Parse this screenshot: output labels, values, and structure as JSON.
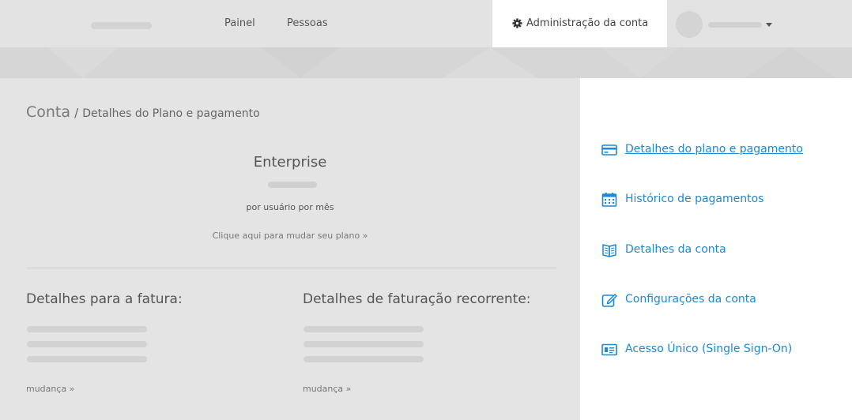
{
  "nav": {
    "painel": "Painel",
    "pessoas": "Pessoas",
    "admin": "Administração da conta"
  },
  "breadcrumb": {
    "root": "Conta",
    "separator": "/",
    "current": "Detalhes do Plano e pagamento"
  },
  "plan": {
    "name": "Enterprise",
    "per_user": "por usuário por mês",
    "change_plan": "Clique aqui para mudar seu plano »"
  },
  "invoice": {
    "heading": "Detalhes para a fatura:",
    "change": "mudança »"
  },
  "recurring": {
    "heading": "Detalhes de faturação recorrente:",
    "change": "mudança »"
  },
  "sidebar": {
    "items": [
      {
        "label": "Detalhes do plano e pagamento",
        "icon": "credit-card-icon",
        "active": true
      },
      {
        "label": "Histórico de pagamentos",
        "icon": "calendar-icon",
        "active": false
      },
      {
        "label": "Detalhes da conta",
        "icon": "book-icon",
        "active": false
      },
      {
        "label": "Configurações da conta",
        "icon": "edit-icon",
        "active": false
      },
      {
        "label": "Acesso Único (Single Sign-On)",
        "icon": "id-card-icon",
        "active": false
      }
    ]
  },
  "colors": {
    "link": "#1e88d4",
    "background": "#e4e4e4",
    "panel": "#ffffff"
  }
}
